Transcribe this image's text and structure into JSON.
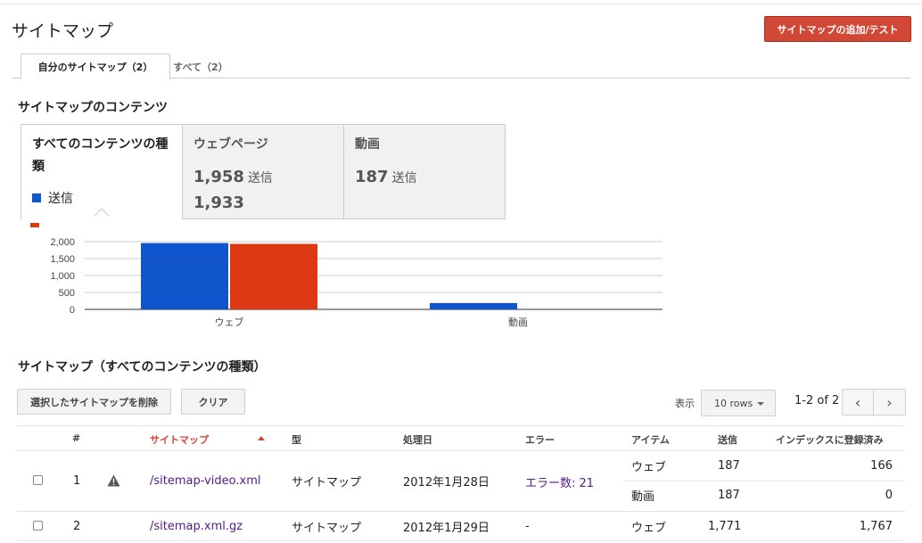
{
  "page": {
    "title": "サイトマップ",
    "add_button": "サイトマップの追加/テスト"
  },
  "tabs": [
    {
      "label": "自分のサイトマップ（2）",
      "active": true
    },
    {
      "label": "すべて（2）",
      "active": false
    }
  ],
  "content_section": {
    "title": "サイトマップのコンテンツ"
  },
  "cards": {
    "all": {
      "title": "すべてのコンテンツの種類",
      "legend_submitted": "送信"
    },
    "web": {
      "title": "ウェブページ",
      "submitted": "1,958",
      "submitted_unit": "送信",
      "indexed": "1,933"
    },
    "video": {
      "title": "動画",
      "submitted": "187",
      "submitted_unit": "送信"
    }
  },
  "colors": {
    "submitted": "#1155cc",
    "indexed": "#dc3912",
    "accent": "#d14836",
    "link": "#551a8b"
  },
  "chart_data": {
    "type": "bar",
    "categories": [
      "ウェブ",
      "動画"
    ],
    "series": [
      {
        "name": "送信",
        "values": [
          1958,
          187
        ]
      },
      {
        "name": "",
        "values": [
          1933,
          0
        ]
      }
    ],
    "ylim": [
      0,
      2000
    ],
    "yticks": [
      "2,000",
      "1,500",
      "1,000",
      "500",
      "0"
    ],
    "grid": true
  },
  "list_section": {
    "title": "サイトマップ（すべてのコンテンツの種類）"
  },
  "toolbar": {
    "delete_button": "選択したサイトマップを削除",
    "clear_button": "クリア",
    "display_label": "表示",
    "rows_select": "10 rows",
    "pager_text": "1-2 of 2",
    "prev": "‹",
    "next": "›"
  },
  "table": {
    "headers": {
      "num": "#",
      "sitemap": "サイトマップ",
      "type": "型",
      "processed": "処理日",
      "errors": "エラー",
      "items": "アイテム",
      "submitted": "送信",
      "indexed": "インデックスに登録済み"
    },
    "rows": [
      {
        "num": "1",
        "path": "/sitemap-video.xml",
        "type": "サイトマップ",
        "processed": "2012年1月28日",
        "errors": "エラー数: 21",
        "items": [
          {
            "item": "ウェブ",
            "submitted": "187",
            "indexed": "166"
          },
          {
            "item": "動画",
            "submitted": "187",
            "indexed": "0"
          }
        ]
      },
      {
        "num": "2",
        "path": "/sitemap.xml.gz",
        "type": "サイトマップ",
        "processed": "2012年1月29日",
        "errors": "-",
        "items": [
          {
            "item": "ウェブ",
            "submitted": "1,771",
            "indexed": "1,767"
          }
        ]
      }
    ]
  }
}
